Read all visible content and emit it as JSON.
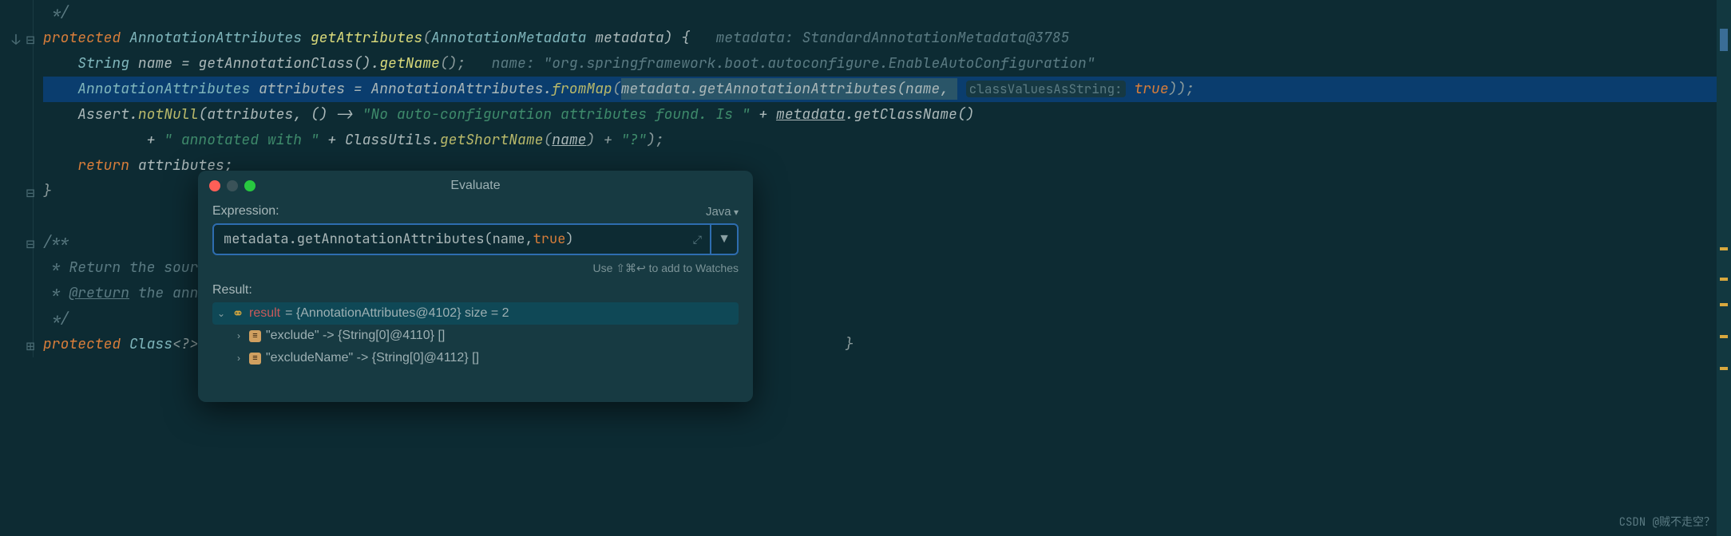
{
  "code": {
    "l1": " */",
    "l2_kw": "protected",
    "l2_type": "AnnotationAttributes",
    "l2_method": "getAttributes",
    "l2_param_type": "AnnotationMetadata",
    "l2_param": " metadata) {",
    "l2_hint_pname": "metadata: ",
    "l2_hint": "StandardAnnotationMetadata@3785",
    "l3_type": "String",
    "l3_rest": " name = getAnnotationClass().",
    "l3_m2": "getName",
    "l3_end": "();",
    "l3_hint_pname": "name: ",
    "l3_hint": "\"org.springframework.boot.autoconfigure.EnableAutoConfiguration\"",
    "l4_type": "AnnotationAttributes",
    "l4_mid": " attributes = AnnotationAttributes.",
    "l4_m": "fromMap",
    "l4_sel": "metadata.getAnnotationAttributes(name, ",
    "l4_hint": "classValuesAsString:",
    "l4_end1": " true",
    "l4_end2": "));",
    "l5_a": "Assert.",
    "l5_m": "notNull",
    "l5_b": "(attributes, () -> ",
    "l5_s1": "\"No auto-configuration attributes found. Is \"",
    "l5_c": " + ",
    "l5_d": "metadata",
    "l5_e": ".getClassName()",
    "l6_a": "+ ",
    "l6_s1": "\" annotated with \"",
    "l6_b": " + ClassUtils.",
    "l6_m": "getShortName",
    "l6_c": "(",
    "l6_d": "name",
    "l6_e": ") + ",
    "l6_s2": "\"?\"",
    "l6_f": ");",
    "l7_kw": "return",
    "l7_rest": " attributes;",
    "l8": "}",
    "l10": "/**",
    "l11": " * Return the sour",
    "l12a": " * ",
    "l12b": "@return",
    "l12c": " the ann",
    "l13": " */",
    "l14_kw": "protected",
    "l14_type": " Class",
    "l14_rest": "<?>"
  },
  "popup": {
    "title": "Evaluate",
    "expression_label": "Expression:",
    "language": "Java",
    "expr_p1": "metadata.getAnnotationAttributes(name, ",
    "expr_kw": "true",
    "expr_p2": ")",
    "hint": "Use ⇧⌘↩ to add to Watches",
    "result_label": "Result:",
    "tree": {
      "root_name": "result",
      "root_val": "= {AnnotationAttributes@4102}  size = 2",
      "c1": "\"exclude\" -> {String[0]@4110} []",
      "c2": "\"excludeName\" -> {String[0]@4112} []"
    }
  },
  "watermark": "CSDN @贼不走空？"
}
